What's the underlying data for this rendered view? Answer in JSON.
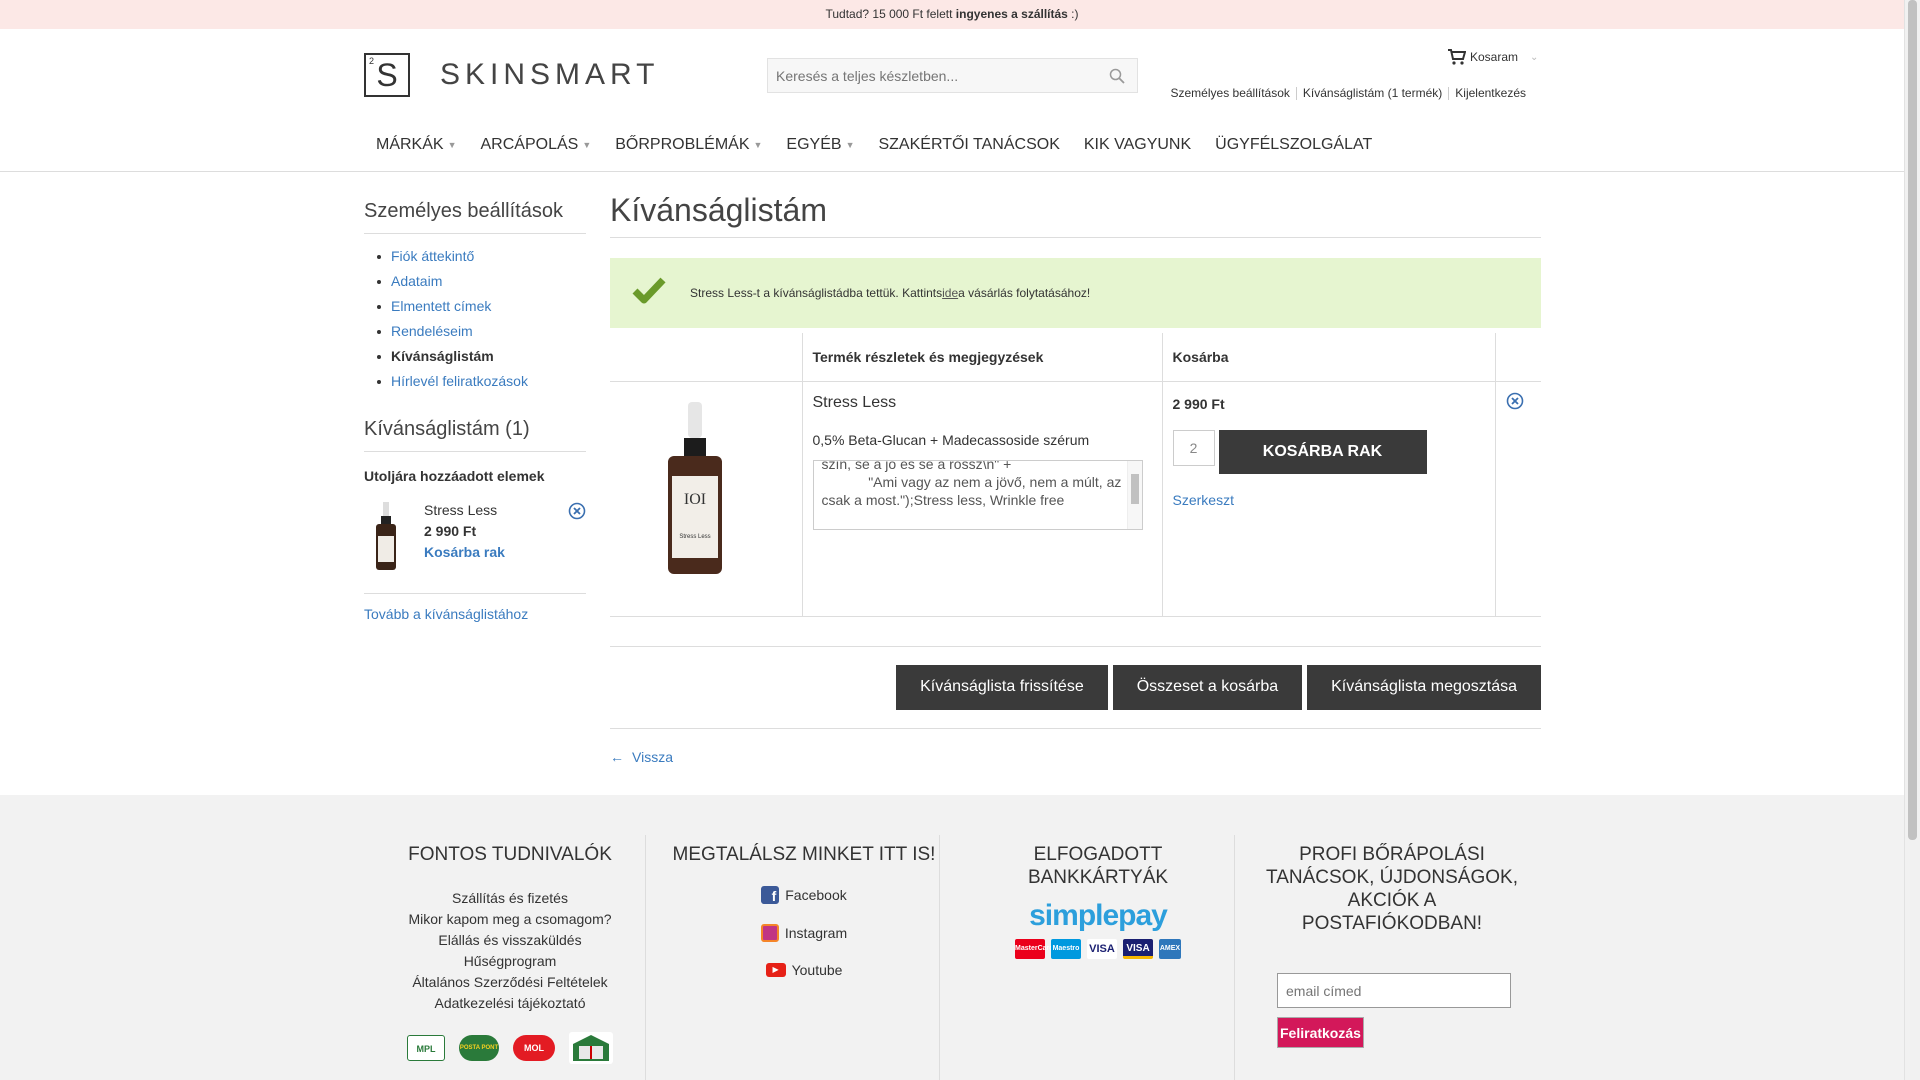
{
  "topbar": {
    "text_pre": "Tudtad? 15 000 Ft felett ",
    "text_bold": "ingyenes a szállítás",
    "text_post": " :)"
  },
  "logo": {
    "box_letter": "S",
    "box_sup": "2",
    "word": "SKINSMART"
  },
  "search": {
    "placeholder": "Keresés a teljes készletben..."
  },
  "cart": {
    "label": "Kosaram"
  },
  "usermenu": [
    "Személyes beállítások",
    "Kívánságlistám (1 termék)",
    "Kijelentkezés"
  ],
  "nav": [
    {
      "label": "MÁRKÁK",
      "dropdown": true
    },
    {
      "label": "ARCÁPOLÁS",
      "dropdown": true
    },
    {
      "label": "BŐRPROBLÉMÁK",
      "dropdown": true
    },
    {
      "label": "EGYÉB",
      "dropdown": true
    },
    {
      "label": "SZAKÉRTŐI TANÁCSOK",
      "dropdown": false
    },
    {
      "label": "KIK VAGYUNK",
      "dropdown": false
    },
    {
      "label": "ÜGYFÉLSZOLGÁLAT",
      "dropdown": false
    }
  ],
  "sidebar": {
    "title": "Személyes beállítások",
    "items": [
      "Fiók áttekintő",
      "Adataim",
      "Elmentett címek",
      "Rendeléseim",
      "Kívánságlistám",
      "Hírlevél feliratkozások"
    ],
    "active_index": 4,
    "wishlist_title": "Kívánságlistám (1)",
    "recent_title": "Utoljára hozzáadott elemek",
    "recent_item": {
      "name": "Stress Less",
      "price": "2 990 Ft",
      "cart_link": "Kosárba rak"
    },
    "more_link": "Tovább a kívánságlistához"
  },
  "main": {
    "title": "Kívánságlistám",
    "notice": {
      "pre": "Stress Less-t a kívánságlistádba tettük. Kattints",
      "link": "ide",
      "post": "a vásárlás folytatásához!"
    },
    "table": {
      "headers": [
        "",
        "Termék részletek és megjegyzések",
        "Kosárba",
        ""
      ],
      "row": {
        "name": "Stress Less",
        "description": "0,5% Beta-Glucan + Madecassoside szérum",
        "comment": "szín, se a jó és se a rossz\\n\" +\n            \"Ami vagy az nem a jövő, nem a múlt, az csak a most.\");Stress less, Wrinkle free",
        "price": "2 990 Ft",
        "qty": "2",
        "add_button": "KOSÁRBA RAK",
        "edit_link": "Szerkeszt",
        "bottle_label": "Stress Less"
      }
    },
    "actions": [
      "Kívánságlista frissítése",
      "Összeset a kosárba",
      "Kívánságlista megosztása"
    ],
    "back_link": "Vissza"
  },
  "footer": {
    "col1": {
      "title": "FONTOS TUDNIVALÓK",
      "links": [
        "Szállítás és fizetés",
        "Mikor kapom meg a csomagom?",
        "Elállás és visszaküldés",
        "Hűségprogram",
        "Általános Szerződési Feltételek",
        "Adatkezelési tájékoztató"
      ],
      "logos": [
        "MPL",
        "POSTA PONT",
        "MOL"
      ]
    },
    "col2": {
      "title": "MEGTALÁLSZ MINKET ITT IS!",
      "links": [
        "Facebook",
        "Instagram",
        "Youtube"
      ]
    },
    "col3": {
      "title_line1": "ELFOGADOTT",
      "title_line2": "BANKKÁRTYÁK",
      "brand": "simplepay",
      "cards": [
        "MasterCard",
        "Maestro",
        "VISA",
        "VISA",
        "AMEX"
      ]
    },
    "col4": {
      "title_lines": [
        "PROFI BŐRÁPOLÁSI",
        "TANÁCSOK, ÚJDONSÁGOK,",
        "AKCIÓK A",
        "POSTAFIÓKODBAN!"
      ],
      "email_placeholder": "email címed",
      "button": "Feliratkozás"
    }
  },
  "colors": {
    "link": "#3a7bbf",
    "notice_bg": "#e6f5d0",
    "check": "#6a9a2a",
    "button_dark": "#3a3a3a",
    "subscribe": "#d3185a",
    "topbar_bg": "#fce8e6"
  }
}
